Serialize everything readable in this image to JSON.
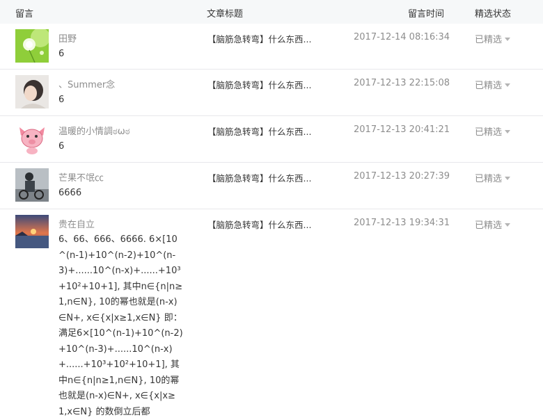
{
  "header": {
    "col_comment": "留言",
    "col_article": "文章标题",
    "col_time": "留言时间",
    "col_status": "精选状态"
  },
  "rows": [
    {
      "nickname": "田野",
      "content": "6",
      "article": "【脑筋急转弯】什么东西...",
      "time": "2017-12-14 08:16:34",
      "status": "已精选",
      "avatar_icon": "dandelion-avatar"
    },
    {
      "nickname": "、Summer念",
      "content": "6",
      "article": "【脑筋急转弯】什么东西...",
      "time": "2017-12-13 22:15:08",
      "status": "已精选",
      "avatar_icon": "girl-photo-avatar"
    },
    {
      "nickname": "温暖的小情調ಠωಠ",
      "content": "6",
      "article": "【脑筋急转弯】什么东西...",
      "time": "2017-12-13 20:41:21",
      "status": "已精选",
      "avatar_icon": "pink-pig-avatar"
    },
    {
      "nickname": "芒果不氓㏄",
      "content": "6666",
      "article": "【脑筋急转弯】什么东西...",
      "time": "2017-12-13 20:27:39",
      "status": "已精选",
      "avatar_icon": "street-photo-avatar"
    },
    {
      "nickname": "贵在自立",
      "content": "6、66、666、6666. 6×[10^(n-1)+10^(n-2)+10^(n-3)+......10^(n-x)+......+10³+10²+10+1], 其中n∈{n|n≥1,n∈N}, 10的幂也就是(n-x)∈N+, x∈{x|x≥1,x∈N} 即：满足6×[10^(n-1)+10^(n-2)+10^(n-3)+......10^(n-x)+......+10³+10²+10+1], 其中n∈{n|n≥1,n∈N}, 10的幂也就是(n-x)∈N+, x∈{x|x≥1,x∈N} 的数倒立后都",
      "article": "【脑筋急转弯】什么东西...",
      "time": "2017-12-13 19:34:31",
      "status": "已精选",
      "avatar_icon": "sunset-sea-avatar"
    }
  ]
}
